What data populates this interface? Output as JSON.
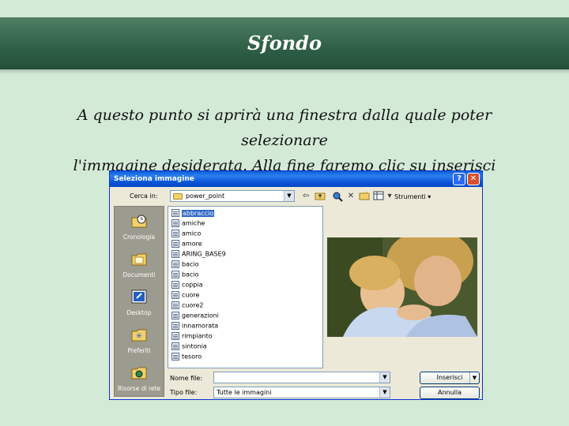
{
  "slide": {
    "title": "Sfondo",
    "subtitle_line1": "A questo punto si aprirà una finestra dalla quale poter selezionare",
    "subtitle_line2": "l'immagine desiderata. Alla fine faremo clic su inserisci"
  },
  "dialog": {
    "title": "Seleziona immagine",
    "help_glyph": "?",
    "close_glyph": "✕",
    "look_in_label": "Cerca in:",
    "look_in_value": "power_point",
    "tools_label": "Strumenti ▾",
    "places": [
      {
        "label": "Cronologia",
        "icon": "history-icon"
      },
      {
        "label": "Documenti",
        "icon": "my-documents-icon"
      },
      {
        "label": "Desktop",
        "icon": "desktop-icon"
      },
      {
        "label": "Preferiti",
        "icon": "favorites-icon"
      },
      {
        "label": "Risorse di rete",
        "icon": "network-places-icon"
      }
    ],
    "files": [
      "abbraccio",
      "amiche",
      "amico",
      "amore",
      "ARING_BASE9",
      "bacio",
      "bacio",
      "coppia",
      "cuore",
      "cuore2",
      "generazioni",
      "innamorata",
      "rimpianto",
      "sintonia",
      "tesoro"
    ],
    "selected_file": "abbraccio",
    "file_name_label": "Nome file:",
    "file_name_value": "",
    "file_type_label": "Tipo file:",
    "file_type_value": "Tutte le immagini",
    "insert_button": "Inserisci",
    "cancel_button": "Annulla"
  },
  "colors": {
    "slide_bg": "#d3ead7",
    "title_bar": "#2f5f46",
    "dialog_title": "#0a5fd8",
    "selection": "#316ac5"
  }
}
